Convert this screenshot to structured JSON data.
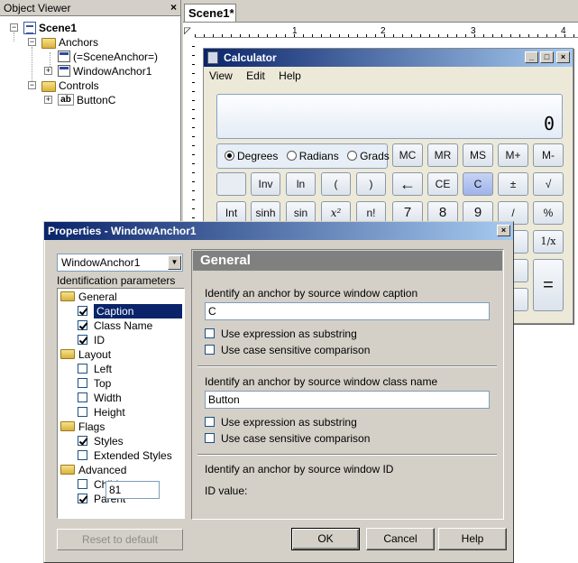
{
  "object_viewer": {
    "title": "Object Viewer",
    "close": "×",
    "tree": {
      "scene": "Scene1",
      "anchors": "Anchors",
      "scene_anchor": "(=SceneAnchor=)",
      "window_anchor": "WindowAnchor1",
      "controls": "Controls",
      "button": "ButtonC"
    }
  },
  "scene_tab": {
    "label": "Scene1*"
  },
  "ruler": {
    "marks": [
      "1",
      "2",
      "3",
      "4"
    ]
  },
  "calculator": {
    "title": "Calculator",
    "menu": [
      "View",
      "Edit",
      "Help"
    ],
    "display": "0",
    "angle_modes": [
      "Degrees",
      "Radians",
      "Grads"
    ],
    "selected_mode": "Degrees",
    "mem_keys": [
      "MC",
      "MR",
      "MS",
      "M+",
      "M-"
    ],
    "row2": [
      "Inv",
      "ln",
      "(",
      ")",
      "←",
      "CE",
      "C",
      "±",
      "√"
    ],
    "row3": [
      "Int",
      "sinh",
      "sin",
      "x²",
      "n!",
      "7",
      "8",
      "9",
      "/",
      "%"
    ],
    "recip": "1/x",
    "equals": "="
  },
  "properties": {
    "title": "Properties - WindowAnchor1",
    "close": "×",
    "combo_value": "WindowAnchor1",
    "ident_label": "Identification parameters",
    "tree": {
      "general": "General",
      "caption": "Caption",
      "class_name": "Class Name",
      "id": "ID",
      "layout": "Layout",
      "left": "Left",
      "top": "Top",
      "width": "Width",
      "height": "Height",
      "flags": "Flags",
      "styles": "Styles",
      "extended_styles": "Extended Styles",
      "advanced": "Advanced",
      "childs": "Childs",
      "parent": "Parent"
    },
    "reset": "Reset to default",
    "panel_title": "General",
    "caption_label": "Identify an anchor by source window caption",
    "caption_value": "C",
    "use_expression": "Use expression as substring",
    "case_sensitive": "Use case sensitive comparison",
    "class_label": "Identify an anchor by source window class name",
    "class_value": "Button",
    "id_label": "Identify an anchor by source window ID",
    "id_value_label": "ID value:",
    "id_value": "81",
    "ok": "OK",
    "cancel": "Cancel",
    "help": "Help"
  }
}
